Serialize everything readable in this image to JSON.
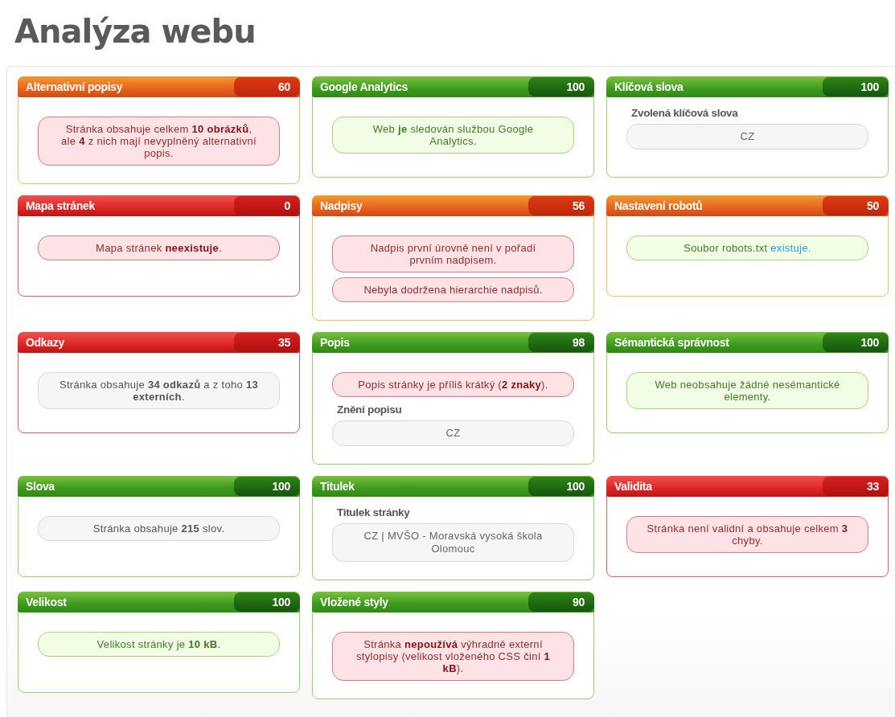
{
  "title": "Analýza webu",
  "cards": [
    {
      "name": "Alternativní popisy",
      "score": "60",
      "kind": "warn",
      "items": [
        {
          "kind": "alert",
          "text": "Stránka obsahuje celkem **10 obrázků**, ale **4** z nich mají nevyplněný alternativní popis."
        }
      ]
    },
    {
      "name": "Google Analytics",
      "score": "100",
      "kind": "pass",
      "items": [
        {
          "kind": "success",
          "text": "Web **je** sledován službou Google Analytics."
        }
      ]
    },
    {
      "name": "Klíčová slova",
      "score": "100",
      "kind": "pass",
      "items": [
        {
          "kind": "field",
          "label": "Zvolená klíčová slova",
          "value": "CZ"
        }
      ]
    },
    {
      "name": "Mapa stránek",
      "score": "0",
      "kind": "fail",
      "items": [
        {
          "kind": "alert",
          "text": "Mapa stránek **neexistuje**."
        }
      ]
    },
    {
      "name": "Nadpisy",
      "score": "56",
      "kind": "warn",
      "items": [
        {
          "kind": "alert",
          "text": "Nadpis první úrovně není v pořadí prvním nadpisem."
        },
        {
          "kind": "alert",
          "text": "Nebyla dodržena hierarchie nadpisů."
        }
      ]
    },
    {
      "name": "Nastavení robotů",
      "score": "50",
      "kind": "warn",
      "items": [
        {
          "kind": "success",
          "text": "Soubor robots.txt",
          "link": "existuje."
        }
      ]
    },
    {
      "name": "Odkazy",
      "score": "35",
      "kind": "fail",
      "items": [
        {
          "kind": "note",
          "text": "Stránka obsahuje **34 odkazů** a z toho **13 externích**."
        }
      ]
    },
    {
      "name": "Popis",
      "score": "98",
      "kind": "pass",
      "items": [
        {
          "kind": "alert",
          "text": "Popis stránky je příliš krátký (**2 znaky**)."
        },
        {
          "kind": "field",
          "label": "Znění popisu",
          "value": "CZ"
        }
      ]
    },
    {
      "name": "Sémantická správnost",
      "score": "100",
      "kind": "pass",
      "items": [
        {
          "kind": "success",
          "text": "Web neobsahuje žádné nesémantické elementy."
        }
      ]
    },
    {
      "name": "Slova",
      "score": "100",
      "kind": "pass",
      "items": [
        {
          "kind": "note",
          "text": "Stránka obsahuje **215** slov."
        }
      ]
    },
    {
      "name": "Titulek",
      "score": "100",
      "kind": "pass",
      "items": [
        {
          "kind": "field",
          "label": "Titulek stránky",
          "value": "CZ | MVŠO - Moravská vysoká škola Olomouc"
        }
      ]
    },
    {
      "name": "Validita",
      "score": "33",
      "kind": "fail",
      "items": [
        {
          "kind": "alert",
          "text": "Stránka není validní a obsahuje celkem **3** chyby."
        }
      ]
    },
    {
      "name": "Velikost",
      "score": "100",
      "kind": "pass",
      "items": [
        {
          "kind": "success",
          "text": "Velikost stránky je **10 kB**."
        }
      ]
    },
    {
      "name": "Vložené styly",
      "score": "90",
      "kind": "pass",
      "items": [
        {
          "kind": "alert",
          "text": "Stránka **nepoužívá** výhradně externí stylopisy (velikost vloženého CSS činí **1 kB**)."
        }
      ]
    }
  ]
}
